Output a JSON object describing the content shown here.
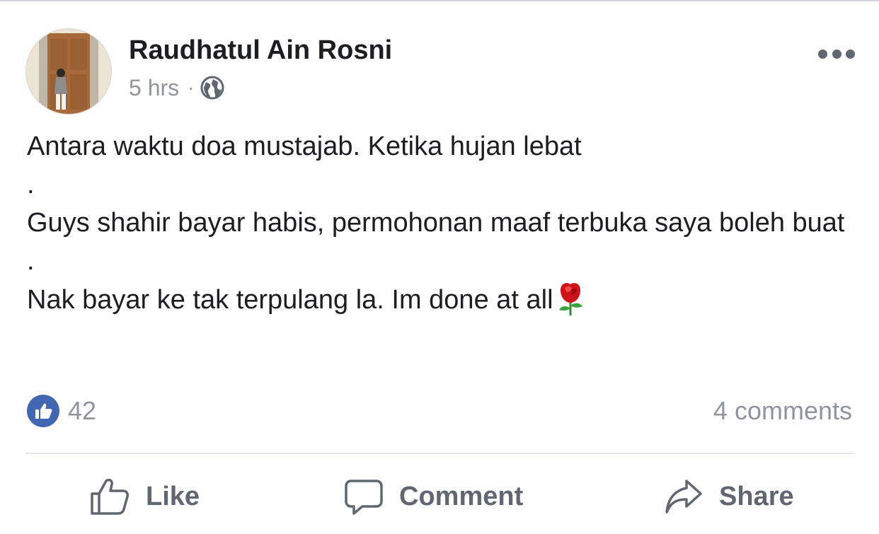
{
  "post": {
    "author": "Raudhatul Ain Rosni",
    "time": "5 hrs",
    "separator": "·",
    "privacy_icon": "globe-icon",
    "lines": [
      "Antara waktu doa mustajab. Ketika hujan lebat",
      ".",
      "Guys shahir bayar habis, permohonan maaf terbuka saya boleh buat",
      ".",
      "Nak bayar ke tak terpulang la. Im done at all"
    ],
    "trailing_icon": "rose-emoji-icon"
  },
  "reactions": {
    "like_count": "42",
    "comments": "4 comments"
  },
  "actions": {
    "like": "Like",
    "comment": "Comment",
    "share": "Share"
  },
  "colors": {
    "like_blue": "#4267b2",
    "muted_text": "#90949c",
    "action_text": "#606770"
  }
}
